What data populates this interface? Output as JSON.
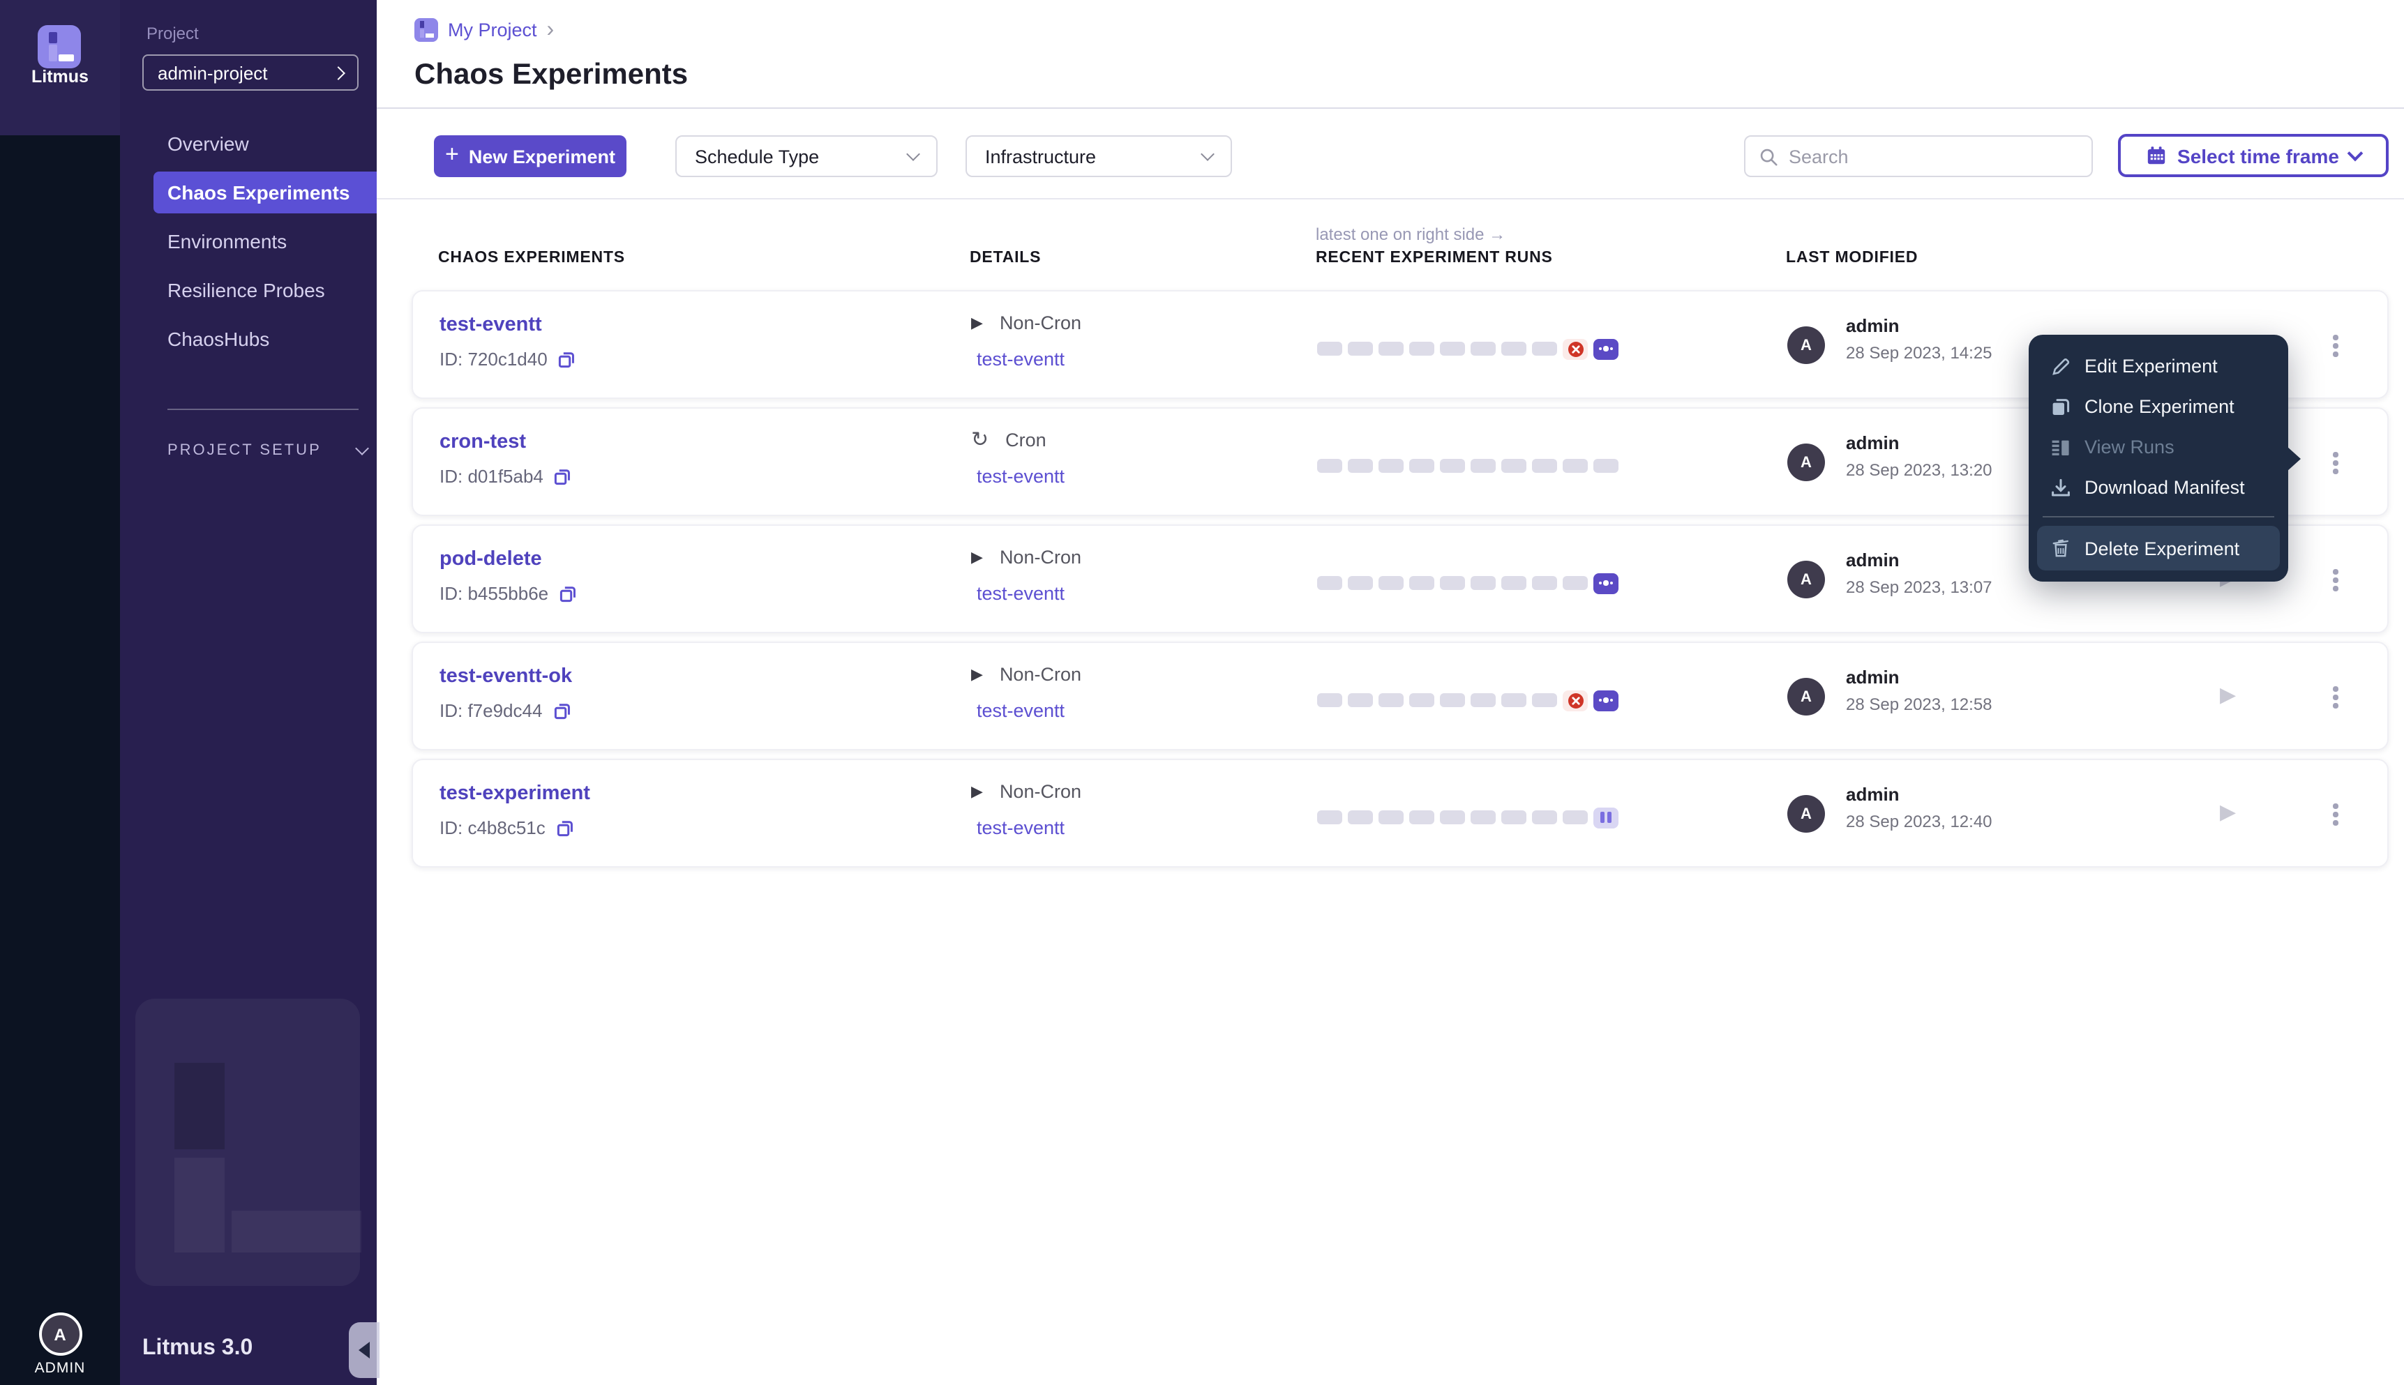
{
  "app": {
    "brand": "Litmus",
    "version": "Litmus 3.0",
    "user_initial": "A",
    "user_label": "ADMIN"
  },
  "sidebar": {
    "project_label": "Project",
    "project_value": "admin-project",
    "items": [
      {
        "label": "Overview",
        "active": false
      },
      {
        "label": "Chaos Experiments",
        "active": true
      },
      {
        "label": "Environments",
        "active": false
      },
      {
        "label": "Resilience Probes",
        "active": false
      },
      {
        "label": "ChaosHubs",
        "active": false
      }
    ],
    "section_label": "PROJECT SETUP"
  },
  "header": {
    "breadcrumb": "My Project",
    "title": "Chaos Experiments"
  },
  "toolbar": {
    "new_experiment": "New Experiment",
    "schedule_type": "Schedule Type",
    "infrastructure": "Infrastructure",
    "search_placeholder": "Search",
    "time_frame": "Select time frame"
  },
  "table": {
    "runs_note": "latest one on right side →",
    "headers": [
      "CHAOS EXPERIMENTS",
      "DETAILS",
      "RECENT EXPERIMENT RUNS",
      "LAST MODIFIED"
    ],
    "rows": [
      {
        "name": "test-eventt",
        "id": "ID: 720c1d40",
        "schedule": "Non-Cron",
        "schedule_icon": "non-cron",
        "link": "test-eventt",
        "runs": [
          "empty",
          "empty",
          "empty",
          "empty",
          "empty",
          "empty",
          "empty",
          "empty",
          "failed",
          "running"
        ],
        "modified_by": "admin",
        "modified_at": "28 Sep 2023, 14:25"
      },
      {
        "name": "cron-test",
        "id": "ID: d01f5ab4",
        "schedule": "Cron",
        "schedule_icon": "cron",
        "link": "test-eventt",
        "runs": [
          "empty",
          "empty",
          "empty",
          "empty",
          "empty",
          "empty",
          "empty",
          "empty",
          "empty",
          "empty"
        ],
        "modified_by": "admin",
        "modified_at": "28 Sep 2023, 13:20"
      },
      {
        "name": "pod-delete",
        "id": "ID: b455bb6e",
        "schedule": "Non-Cron",
        "schedule_icon": "non-cron",
        "link": "test-eventt",
        "runs": [
          "empty",
          "empty",
          "empty",
          "empty",
          "empty",
          "empty",
          "empty",
          "empty",
          "empty",
          "running"
        ],
        "modified_by": "admin",
        "modified_at": "28 Sep 2023, 13:07"
      },
      {
        "name": "test-eventt-ok",
        "id": "ID: f7e9dc44",
        "schedule": "Non-Cron",
        "schedule_icon": "non-cron",
        "link": "test-eventt",
        "runs": [
          "empty",
          "empty",
          "empty",
          "empty",
          "empty",
          "empty",
          "empty",
          "empty",
          "failed",
          "running"
        ],
        "modified_by": "admin",
        "modified_at": "28 Sep 2023, 12:58"
      },
      {
        "name": "test-experiment",
        "id": "ID: c4b8c51c",
        "schedule": "Non-Cron",
        "schedule_icon": "non-cron",
        "link": "test-eventt",
        "runs": [
          "empty",
          "empty",
          "empty",
          "empty",
          "empty",
          "empty",
          "empty",
          "empty",
          "empty",
          "paused"
        ],
        "modified_by": "admin",
        "modified_at": "28 Sep 2023, 12:40"
      }
    ]
  },
  "context_menu": {
    "items": [
      {
        "label": "Edit Experiment",
        "icon": "pencil-icon",
        "disabled": false,
        "highlighted": false,
        "divider_before": false
      },
      {
        "label": "Clone Experiment",
        "icon": "clone-icon",
        "disabled": false,
        "highlighted": false,
        "divider_before": false
      },
      {
        "label": "View Runs",
        "icon": "view-runs-icon",
        "disabled": true,
        "highlighted": false,
        "divider_before": false
      },
      {
        "label": "Download Manifest",
        "icon": "download-icon",
        "disabled": false,
        "highlighted": false,
        "divider_before": false
      },
      {
        "label": "Delete Experiment",
        "icon": "trash-icon",
        "disabled": false,
        "highlighted": true,
        "divider_before": true
      }
    ]
  },
  "colors": {
    "primary": "#5A4AC9",
    "nav_active": "#5B50D5",
    "link": "#5C4FD1",
    "experiment_name": "#4F42BD",
    "failed": "#CF3527",
    "running_badge": "#5B4AC5",
    "paused_badge": "#D9D6F3",
    "menu_bg": "#1F2C42",
    "sidebar_bg": "#281F4F",
    "rail_bg": "#0C1322",
    "rail_top_bg": "#2B2353"
  }
}
